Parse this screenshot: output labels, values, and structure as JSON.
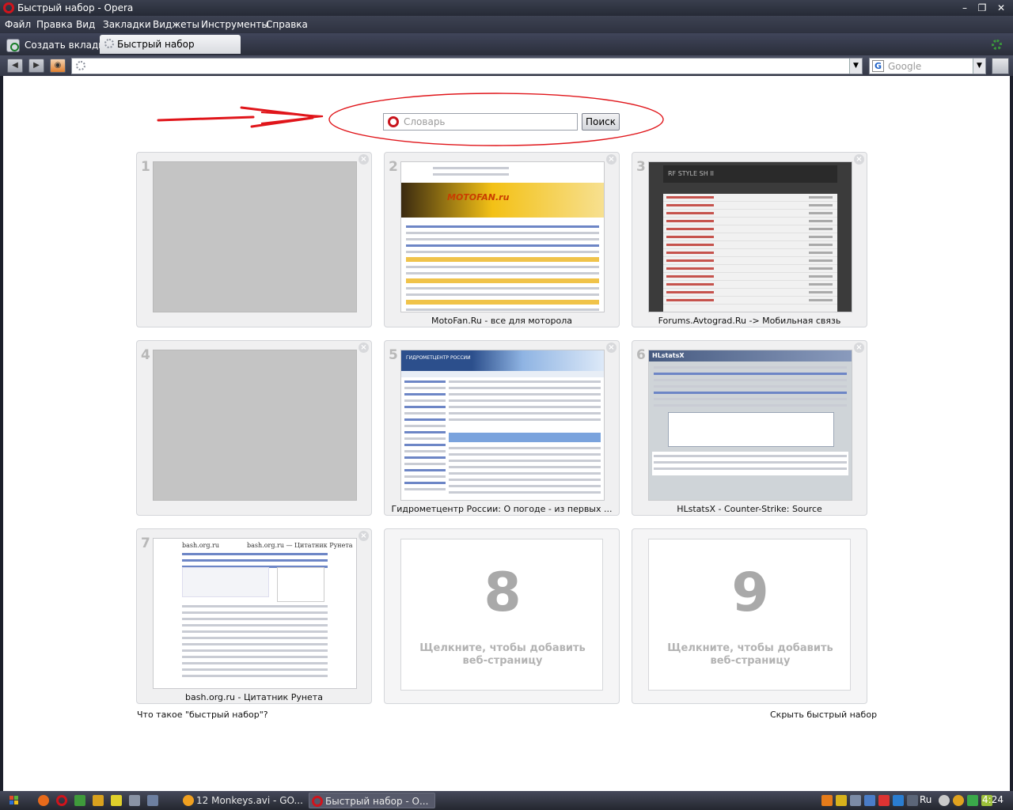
{
  "window": {
    "title": "Быстрый набор - Opera"
  },
  "menu": [
    "Файл",
    "Правка",
    "Вид",
    "Закладки",
    "Виджеты",
    "Инструменты",
    "Справка"
  ],
  "tabs": {
    "new_tab_label": "Создать вкладку",
    "active_tab_label": "Быстрый набор"
  },
  "navbar": {
    "address_value": "",
    "search_placeholder": "Google"
  },
  "speed_search": {
    "placeholder": "Словарь",
    "button_label": "Поиск"
  },
  "dials": [
    {
      "num": "1",
      "caption": "",
      "thumb": "empty"
    },
    {
      "num": "2",
      "caption": "MotoFan.Ru - все для моторола",
      "thumb": "motofan",
      "logo": "MOTOFAN.ru"
    },
    {
      "num": "3",
      "caption": "Forums.Avtograd.Ru -> Мобильная связь",
      "thumb": "avtograd",
      "header": "RF STYLE SH II"
    },
    {
      "num": "4",
      "caption": "",
      "thumb": "empty"
    },
    {
      "num": "5",
      "caption": "Гидрометцентр России: О погоде - из первых ...",
      "thumb": "meteo",
      "header": "ГИДРОМЕТЦЕНТР РОССИИ"
    },
    {
      "num": "6",
      "caption": "HLstatsX - Counter-Strike: Source",
      "thumb": "hlstats",
      "header": "HLstatsX"
    },
    {
      "num": "7",
      "caption": "bash.org.ru - Цитатник Рунета",
      "thumb": "bash",
      "header_left": "bash.org.ru",
      "header_right": "bash.org.ru — Цитатник Рунета"
    }
  ],
  "add_dials": [
    {
      "num": "8",
      "hint": "Щелкните, чтобы добавить веб-страницу"
    },
    {
      "num": "9",
      "hint": "Щелкните, чтобы добавить веб-страницу"
    }
  ],
  "footer": {
    "what_is_link": "Что такое \"быстрый набор\"?",
    "hide_link": "Скрыть быстрый набор"
  },
  "taskbar": {
    "tasks": [
      {
        "label": "12 Monkeys.avi - GO...",
        "active": false
      },
      {
        "label": "Быстрый набор - О...",
        "active": true
      }
    ],
    "lang": "Ru",
    "clock": "4:24"
  },
  "colors": {
    "annotation_red": "#e0151a",
    "opera_red": "#d0141c"
  }
}
